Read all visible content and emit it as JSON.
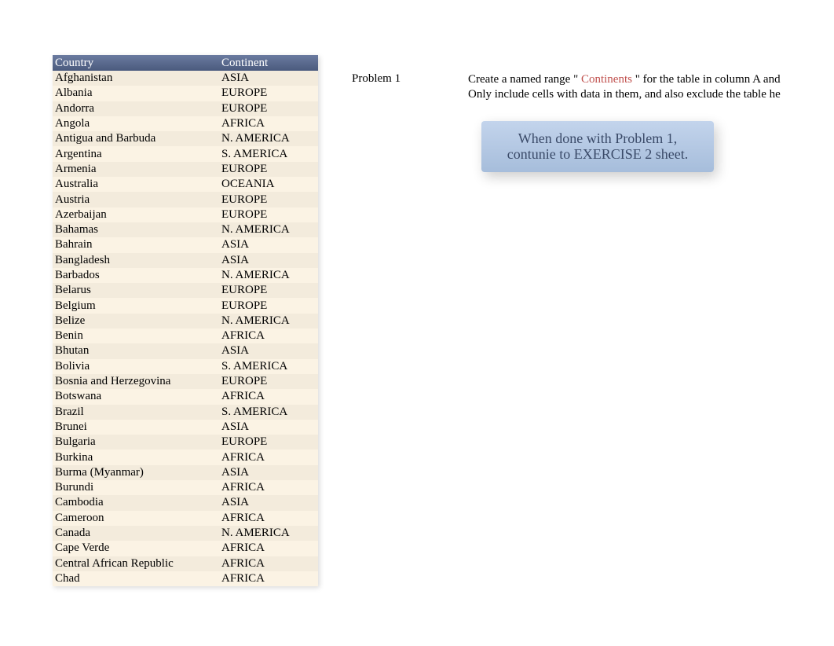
{
  "table": {
    "headers": {
      "country": "Country",
      "continent": "Continent"
    },
    "rows": [
      {
        "country": "Afghanistan",
        "continent": "ASIA"
      },
      {
        "country": "Albania",
        "continent": "EUROPE"
      },
      {
        "country": "Andorra",
        "continent": "EUROPE"
      },
      {
        "country": "Angola",
        "continent": "AFRICA"
      },
      {
        "country": "Antigua and Barbuda",
        "continent": "N. AMERICA"
      },
      {
        "country": "Argentina",
        "continent": "S. AMERICA"
      },
      {
        "country": "Armenia",
        "continent": "EUROPE"
      },
      {
        "country": "Australia",
        "continent": "OCEANIA"
      },
      {
        "country": "Austria",
        "continent": "EUROPE"
      },
      {
        "country": "Azerbaijan",
        "continent": "EUROPE"
      },
      {
        "country": "Bahamas",
        "continent": "N. AMERICA"
      },
      {
        "country": "Bahrain",
        "continent": "ASIA"
      },
      {
        "country": "Bangladesh",
        "continent": "ASIA"
      },
      {
        "country": "Barbados",
        "continent": "N. AMERICA"
      },
      {
        "country": "Belarus",
        "continent": "EUROPE"
      },
      {
        "country": "Belgium",
        "continent": "EUROPE"
      },
      {
        "country": "Belize",
        "continent": "N. AMERICA"
      },
      {
        "country": "Benin",
        "continent": "AFRICA"
      },
      {
        "country": "Bhutan",
        "continent": "ASIA"
      },
      {
        "country": "Bolivia",
        "continent": "S. AMERICA"
      },
      {
        "country": "Bosnia and Herzegovina",
        "continent": "EUROPE"
      },
      {
        "country": "Botswana",
        "continent": "AFRICA"
      },
      {
        "country": "Brazil",
        "continent": "S. AMERICA"
      },
      {
        "country": "Brunei",
        "continent": "ASIA"
      },
      {
        "country": "Bulgaria",
        "continent": "EUROPE"
      },
      {
        "country": "Burkina",
        "continent": "AFRICA"
      },
      {
        "country": "Burma (Myanmar)",
        "continent": "ASIA"
      },
      {
        "country": "Burundi",
        "continent": "AFRICA"
      },
      {
        "country": "Cambodia",
        "continent": "ASIA"
      },
      {
        "country": "Cameroon",
        "continent": "AFRICA"
      },
      {
        "country": "Canada",
        "continent": "N. AMERICA"
      },
      {
        "country": "Cape Verde",
        "continent": "AFRICA"
      },
      {
        "country": "Central African Republic",
        "continent": "AFRICA"
      },
      {
        "country": "Chad",
        "continent": "AFRICA"
      }
    ]
  },
  "problem": {
    "label": "Problem 1",
    "line1_pre": "Create a named range \" ",
    "line1_highlight": "Continents",
    "line1_post": " \" for the table in column A and ",
    "line2": "Only include cells with data in them, and also exclude the table he"
  },
  "callout": {
    "line1": "When done with Problem 1,",
    "line2": "contunie to EXERCISE 2 sheet."
  }
}
